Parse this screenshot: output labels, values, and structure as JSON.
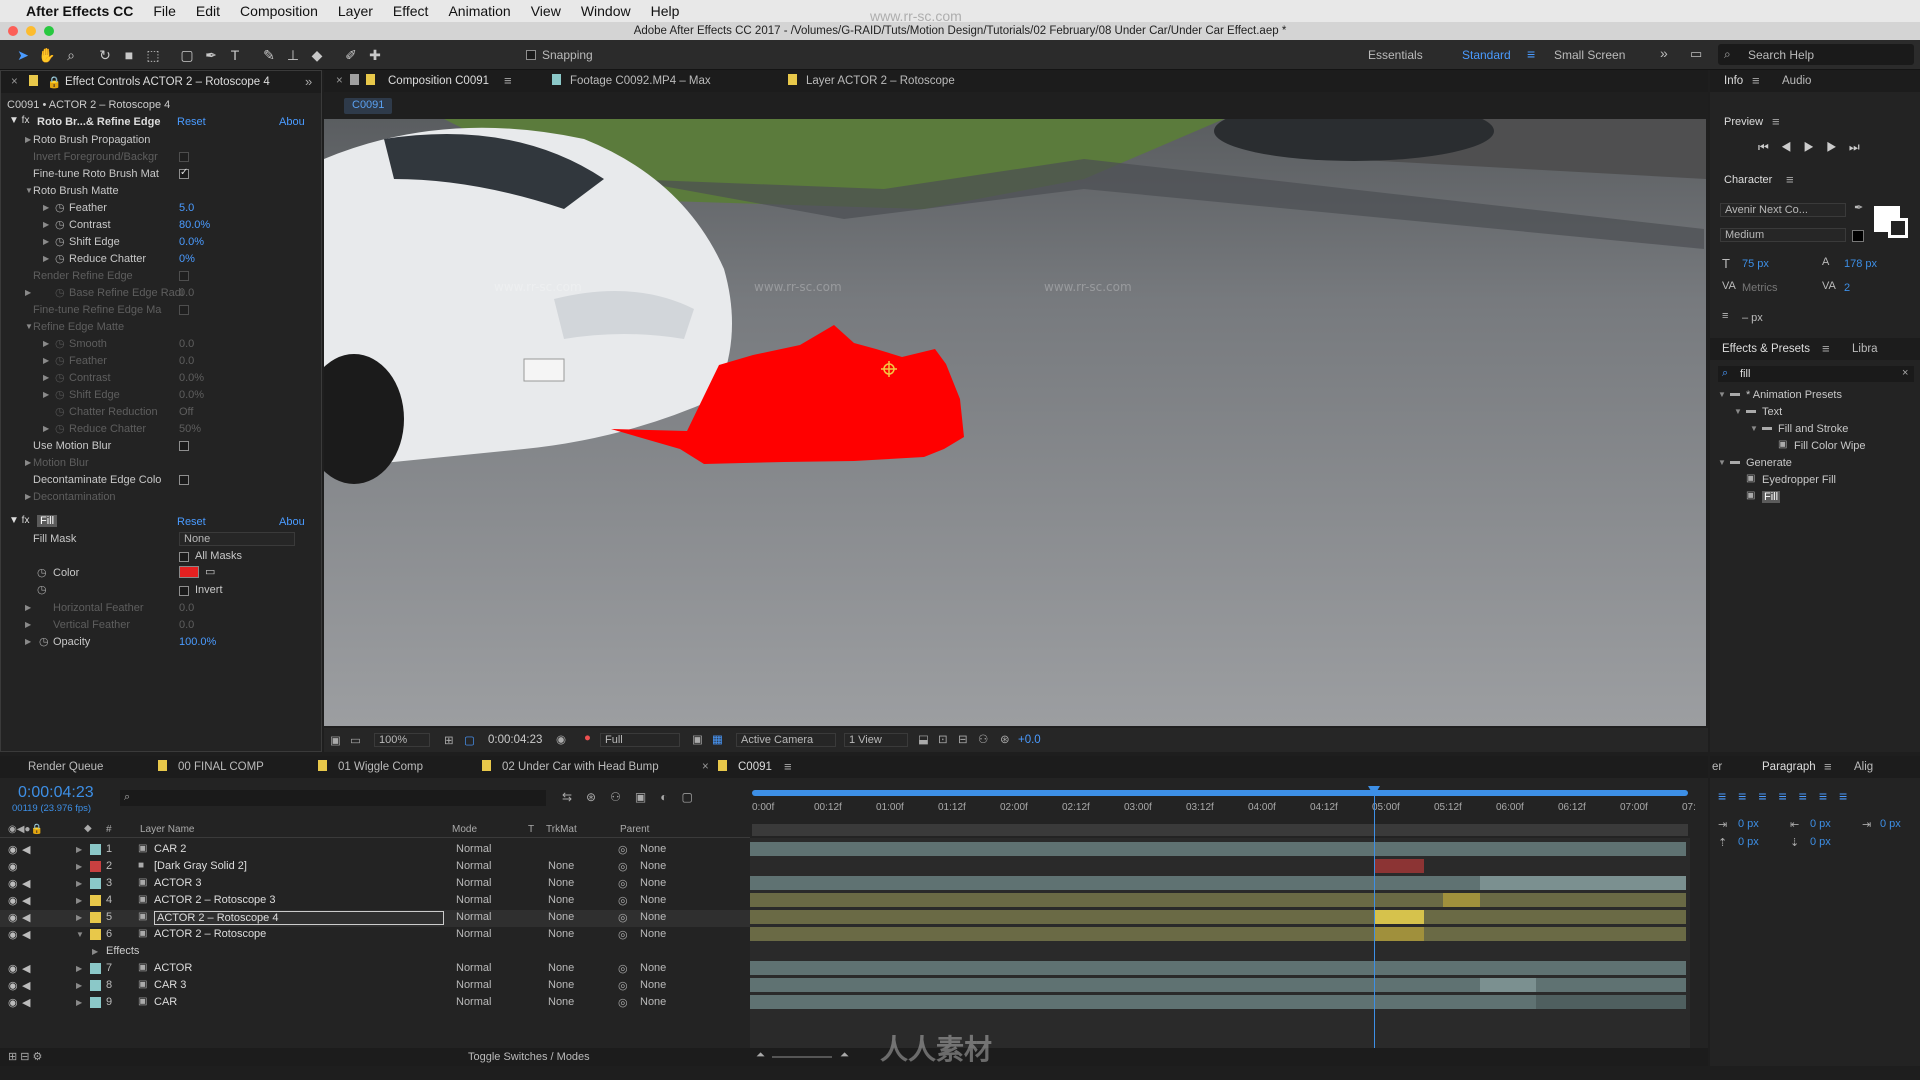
{
  "menubar": {
    "app": "After Effects CC",
    "items": [
      "File",
      "Edit",
      "Composition",
      "Layer",
      "Effect",
      "Animation",
      "View",
      "Window",
      "Help"
    ]
  },
  "titlebar": {
    "text": "Adobe After Effects CC 2017 - /Volumes/G-RAID/Tuts/Motion Design/Tutorials/02 February/08 Under Car/Under Car Effect.aep *"
  },
  "toolbar": {
    "snapping": "Snapping",
    "workspaces": [
      "Essentials",
      "Standard",
      "Small Screen"
    ],
    "search": "Search Help"
  },
  "effect_controls": {
    "tab": "Effect Controls ACTOR 2 – Rotoscope 4",
    "header": "C0091 • ACTOR 2 – Rotoscope 4",
    "roto": {
      "name": "Roto Br...& Refine Edge",
      "reset": "Reset",
      "about": "Abou",
      "rows": [
        {
          "label": "Roto Brush Propagation",
          "value": ""
        },
        {
          "label": "Invert Foreground/Backgr",
          "value": ""
        },
        {
          "label": "Fine-tune Roto Brush Mat",
          "value": ""
        },
        {
          "label": "Roto Brush Matte",
          "value": ""
        },
        {
          "label": "Feather",
          "value": "5.0"
        },
        {
          "label": "Contrast",
          "value": "80.0%"
        },
        {
          "label": "Shift Edge",
          "value": "0.0%"
        },
        {
          "label": "Reduce Chatter",
          "value": "0%"
        },
        {
          "label": "Render Refine Edge",
          "value": ""
        },
        {
          "label": "Base Refine Edge Radi",
          "value": "0.0"
        },
        {
          "label": "Fine-tune Refine Edge Ma",
          "value": ""
        },
        {
          "label": "Refine Edge Matte",
          "value": ""
        },
        {
          "label": "Smooth",
          "value": "0.0"
        },
        {
          "label": "Feather",
          "value": "0.0"
        },
        {
          "label": "Contrast",
          "value": "0.0%"
        },
        {
          "label": "Shift Edge",
          "value": "0.0%"
        },
        {
          "label": "Chatter Reduction",
          "value": "Off"
        },
        {
          "label": "Reduce Chatter",
          "value": "50%"
        },
        {
          "label": "Use Motion Blur",
          "value": ""
        },
        {
          "label": "Motion Blur",
          "value": ""
        },
        {
          "label": "Decontaminate Edge Colo",
          "value": ""
        },
        {
          "label": "Decontamination",
          "value": ""
        }
      ]
    },
    "fill": {
      "name": "Fill",
      "reset": "Reset",
      "about": "Abou",
      "fill_mask_label": "Fill Mask",
      "fill_mask_value": "None",
      "all_masks": "All Masks",
      "color_label": "Color",
      "invert": "Invert",
      "h_feather": "Horizontal Feather",
      "h_feather_value": "0.0",
      "v_feather": "Vertical Feather",
      "v_feather_value": "0.0",
      "opacity": "Opacity",
      "opacity_value": "100.0%",
      "color": "#e42020"
    }
  },
  "viewer": {
    "tabs": [
      "Composition C0091",
      "Footage C0092.MP4 – Max",
      "Layer ACTOR 2 – Rotoscope"
    ],
    "subtab": "C0091",
    "zoom": "100%",
    "timecode": "0:00:04:23",
    "resolution": "Full",
    "camera": "Active Camera",
    "views": "1 View",
    "exposure": "+0.0"
  },
  "right": {
    "info_tabs": [
      "Info",
      "Audio"
    ],
    "preview": "Preview",
    "character": {
      "title": "Character",
      "font": "Avenir Next Co...",
      "style": "Medium",
      "size": "75 px",
      "leading": "178 px",
      "kerning": "Metrics",
      "tracking": "2",
      "stroke": "– px"
    },
    "effects": {
      "tabs": [
        "Effects & Presets",
        "Libra"
      ],
      "search": "fill",
      "tree": [
        {
          "label": "* Animation Presets",
          "level": 0
        },
        {
          "label": "Text",
          "level": 1
        },
        {
          "label": "Fill and Stroke",
          "level": 2
        },
        {
          "label": "Fill Color Wipe",
          "level": 3
        },
        {
          "label": "Generate",
          "level": 0
        },
        {
          "label": "Eyedropper Fill",
          "level": 1
        },
        {
          "label": "Fill",
          "level": 1
        }
      ]
    },
    "paragraph": {
      "tabs": [
        "er",
        "Paragraph",
        "Alig"
      ],
      "values": [
        "0 px",
        "0 px",
        "0 px",
        "0 px",
        "0 px"
      ]
    }
  },
  "timeline": {
    "tabs": [
      "Render Queue",
      "00 FINAL COMP",
      "01 Wiggle Comp",
      "02 Under Car with Head Bump",
      "C0091"
    ],
    "timecode": "0:00:04:23",
    "frames": "00119 (23.976 fps)",
    "columns": {
      "num": "#",
      "name": "Layer Name",
      "mode": "Mode",
      "t": "T",
      "trkmat": "TrkMat",
      "parent": "Parent"
    },
    "ruler": [
      "0:00f",
      "00:12f",
      "01:00f",
      "01:12f",
      "02:00f",
      "02:12f",
      "03:00f",
      "03:12f",
      "04:00f",
      "04:12f",
      "05:00f",
      "05:12f",
      "06:00f",
      "06:12f",
      "07:00f",
      "07:"
    ],
    "layers": [
      {
        "num": "1",
        "name": "CAR 2",
        "mode": "Normal",
        "trkmat": "",
        "parent": "None",
        "color": "#8bc8c8"
      },
      {
        "num": "2",
        "name": "[Dark Gray Solid 2]",
        "mode": "Normal",
        "trkmat": "None",
        "parent": "None",
        "color": "#c84040"
      },
      {
        "num": "3",
        "name": "ACTOR 3",
        "mode": "Normal",
        "trkmat": "None",
        "parent": "None",
        "color": "#8bc8c8"
      },
      {
        "num": "4",
        "name": "ACTOR 2 – Rotoscope 3",
        "mode": "Normal",
        "trkmat": "None",
        "parent": "None",
        "color": "#e8c84a"
      },
      {
        "num": "5",
        "name": "ACTOR 2 – Rotoscope 4",
        "mode": "Normal",
        "trkmat": "None",
        "parent": "None",
        "color": "#e8c84a"
      },
      {
        "num": "6",
        "name": "ACTOR 2 – Rotoscope",
        "mode": "Normal",
        "trkmat": "None",
        "parent": "None",
        "color": "#e8c84a"
      },
      {
        "num": "",
        "name": "Effects",
        "mode": "",
        "trkmat": "",
        "parent": "",
        "color": ""
      },
      {
        "num": "7",
        "name": "ACTOR",
        "mode": "Normal",
        "trkmat": "None",
        "parent": "None",
        "color": "#8bc8c8"
      },
      {
        "num": "8",
        "name": "CAR 3",
        "mode": "Normal",
        "trkmat": "None",
        "parent": "None",
        "color": "#8bc8c8"
      },
      {
        "num": "9",
        "name": "CAR",
        "mode": "Normal",
        "trkmat": "None",
        "parent": "None",
        "color": "#8bc8c8"
      }
    ],
    "footer": "Toggle Switches / Modes"
  },
  "watermarks": [
    "www.rr-sc.com",
    "人人素材"
  ]
}
